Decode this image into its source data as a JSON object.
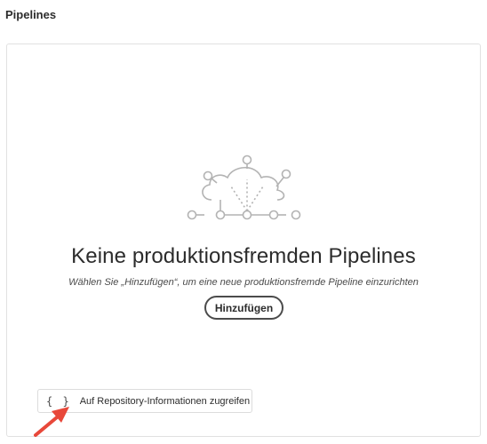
{
  "page": {
    "title": "Pipelines"
  },
  "empty_state": {
    "illustration_icon": "cloud-network-icon",
    "title": "Keine produktionsfremden Pipelines",
    "description": "Wählen Sie „Hinzufügen“, um eine neue produktionsfremde Pipeline einzurichten",
    "add_button_label": "Hinzufügen"
  },
  "repository": {
    "icon": "braces-icon",
    "icon_glyph": "{ }",
    "label": "Auf Repository-Informationen zugreifen"
  },
  "annotation": {
    "icon": "red-arrow-icon",
    "color": "#e8483a"
  },
  "colors": {
    "text": "#2c2c2c",
    "border": "#e1e1e1",
    "illustration": "#b3b3b3"
  }
}
